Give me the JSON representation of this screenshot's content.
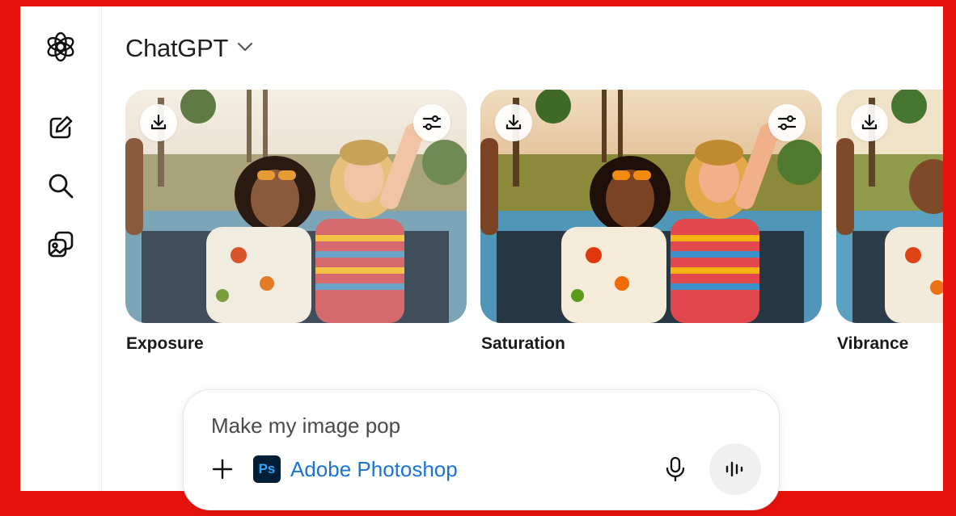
{
  "app": {
    "title": "ChatGPT",
    "icons": {
      "logo": "openai-logo-icon",
      "new_chat": "new-chat-icon",
      "search": "search-icon",
      "library": "image-library-icon",
      "dropdown": "chevron-down-icon"
    }
  },
  "cards": [
    {
      "label": "Exposure",
      "download_icon": "download-icon",
      "adjust_icon": "sliders-icon"
    },
    {
      "label": "Saturation",
      "download_icon": "download-icon",
      "adjust_icon": "sliders-icon"
    },
    {
      "label": "Vibrance",
      "download_icon": "download-icon",
      "adjust_icon": "sliders-icon"
    }
  ],
  "composer": {
    "placeholder": "Make my image pop",
    "tool_name": "Adobe Photoshop",
    "tool_logo_text": "Ps",
    "icons": {
      "add": "plus-icon",
      "mic": "microphone-icon",
      "voice": "voice-mode-icon"
    }
  },
  "colors": {
    "background_border": "#e8120c",
    "photoshop_blue": "#31a8ff",
    "photoshop_dark": "#001e36",
    "link_blue": "#1a73d9"
  }
}
